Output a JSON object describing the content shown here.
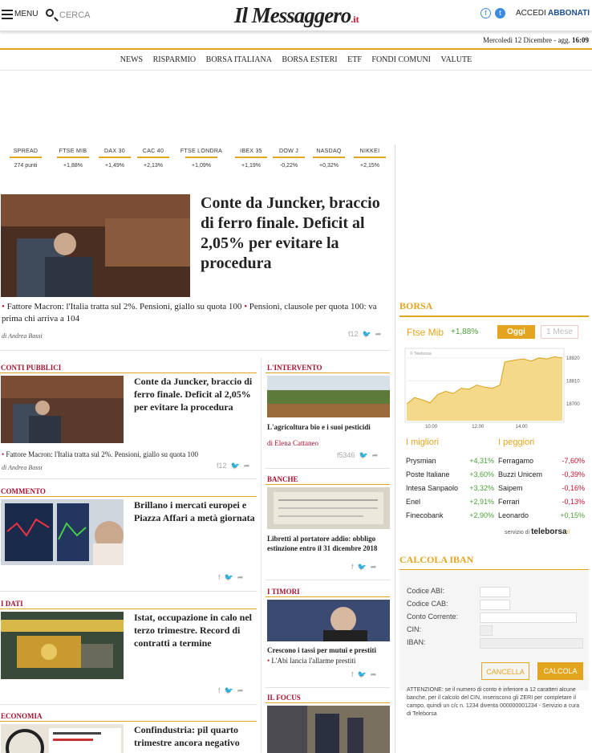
{
  "header": {
    "menu_label": "MENU",
    "search_label": "CERCA",
    "logo_text": "Il Messaggero",
    "logo_suffix": ".it",
    "facebook_icon": "f",
    "twitter_icon": "t",
    "login_label": "ACCEDI",
    "subscribe_label": "ABBONATI",
    "date_text": "Mercoledì 12 Dicembre - agg.",
    "time_text": "16:09"
  },
  "nav": {
    "items": [
      "NEWS",
      "RISPARMIO",
      "BORSA ITALIANA",
      "BORSA ESTERI",
      "ETF",
      "FONDI COMUNI",
      "VALUTE"
    ]
  },
  "markets": [
    {
      "name": "SPREAD",
      "value": "274  punti"
    },
    {
      "name": "FTSE MIB",
      "value": "+1,88%"
    },
    {
      "name": "DAX 30",
      "value": "+1,49%"
    },
    {
      "name": "CAC 40",
      "value": "+2,13%"
    },
    {
      "name": "FTSE LONDRA",
      "value": "+1,09%"
    },
    {
      "name": "IBEX 35",
      "value": "+1,19%"
    },
    {
      "name": "DOW J",
      "value": "-0,22%"
    },
    {
      "name": "NASDAQ",
      "value": "+0,32%"
    },
    {
      "name": "NIKKEI",
      "value": "+2,15%"
    }
  ],
  "lead": {
    "title": "Conte da Juncker, braccio di ferro finale. Deficit al 2,05% per evitare la procedura",
    "link1": "Fattore Macron: l'Italia tratta sul 2%. Pensioni, giallo su quota 100",
    "link2": "Pensioni, clausole per quota 100: va prima chi arriva a 104",
    "byline": "di Andrea Bassi",
    "share_count": "12"
  },
  "left_articles": [
    {
      "section": "CONTI PUBBLICI",
      "title": "Conte da Juncker, braccio di ferro finale. Deficit al 2,05% per evitare la procedura",
      "link": "Fattore Macron: l'Italia tratta sul 2%. Pensioni, giallo su quota 100",
      "byline": "di Andrea Bassi",
      "share_count": "12"
    },
    {
      "section": "COMMENTO",
      "title": "Brillano i mercati europei e Piazza Affari a metà giornata"
    },
    {
      "section": "I DATI",
      "title": "Istat, occupazione in calo nel terzo trimestre. Record di contratti a termine"
    },
    {
      "section": "ECONOMIA",
      "title": "Confindustria: pil quarto trimestre ancora negativo"
    }
  ],
  "mid_articles": [
    {
      "section": "L'INTERVENTO",
      "title": "L'agricoltura bio e i suoi pesticidi",
      "author": "di Elena Cattaneo",
      "share_count": "5346"
    },
    {
      "section": "BANCHE",
      "title": "Libretti al portatore addio: obbligo estinzione entro il 31 dicembre 2018"
    },
    {
      "section": "I TIMORI",
      "title": "Crescono i tassi per mutui e prestiti",
      "link": "L'Abi lancia l'allarme prestiti"
    },
    {
      "section": "IL FOCUS"
    }
  ],
  "borsa": {
    "heading": "BORSA",
    "index_name": "Ftse Mib",
    "index_change": "+1,88%",
    "tab_today": "Oggi",
    "tab_month": "1 Mese",
    "watermark": "© Teleborsa",
    "best_heading": "I migliori",
    "worst_heading": "I peggiori",
    "best": [
      {
        "name": "Prysmian",
        "change": "+4,31%"
      },
      {
        "name": "Poste Italiane",
        "change": "+3,60%"
      },
      {
        "name": "Intesa Sanpaolo",
        "change": "+3,32%"
      },
      {
        "name": "Enel",
        "change": "+2,91%"
      },
      {
        "name": "Finecobank",
        "change": "+2,90%"
      }
    ],
    "worst": [
      {
        "name": "Ferragamo",
        "change": "-7,60%"
      },
      {
        "name": "Buzzi Unicem",
        "change": "-0,39%"
      },
      {
        "name": "Saipem",
        "change": "-0,16%"
      },
      {
        "name": "Ferrari",
        "change": "-0,13%"
      },
      {
        "name": "Leonardo",
        "change": "+0,15%"
      }
    ],
    "service_label": "servizio di",
    "service_brand": "teleborsa"
  },
  "chart_data": {
    "type": "area",
    "x_ticks": [
      "10.00",
      "12.00",
      "14.00"
    ],
    "y_ticks": [
      18700,
      18810,
      18920
    ],
    "ylim": [
      18620,
      18950
    ],
    "x": [
      0,
      0.05,
      0.1,
      0.15,
      0.2,
      0.25,
      0.3,
      0.35,
      0.4,
      0.45,
      0.5,
      0.55,
      0.6,
      0.63,
      0.66,
      0.7,
      0.75,
      0.8,
      0.85,
      0.9,
      0.95,
      1.0
    ],
    "values": [
      18700,
      18730,
      18720,
      18705,
      18745,
      18760,
      18750,
      18775,
      18770,
      18790,
      18780,
      18775,
      18790,
      18900,
      18905,
      18910,
      18915,
      18905,
      18920,
      18915,
      18925,
      18920
    ]
  },
  "iban": {
    "heading": "CALCOLA IBAN",
    "labels": [
      "Codice ABI:",
      "Codice CAB:",
      "Conto Corrente:",
      "CIN:",
      "IBAN:"
    ],
    "cancel_label": "CANCELLA",
    "calc_label": "CALCOLA",
    "note": "ATTENZIONE: se il numero di conto è inferiore a 12 caratteri alcune banche, per il calcolo del CIN, inseriscono gli ZERI per completare il campo, quindi un c/c n. 1234 diventa 000000001234 - Servizio a cura di Teleborsa"
  },
  "colors": {
    "gold": "#e3a51f",
    "red": "#c8102e",
    "green": "#4a9f38"
  }
}
